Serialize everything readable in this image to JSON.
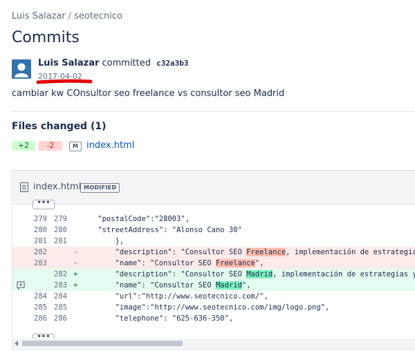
{
  "breadcrumb": {
    "owner": "Luis Salazar",
    "separator": "/",
    "repo": "seotecnico"
  },
  "page_title": "Commits",
  "commit": {
    "author": "Luis Salazar",
    "verb": "committed",
    "hash": "c32a3b3",
    "date": "2017-04-02",
    "message": "cambiar kw COnsultor seo freelance vs consultor seo Madrid"
  },
  "files_changed": {
    "title": "Files changed (1)",
    "added": "+2",
    "removed": "-2",
    "status_letter": "M",
    "file_name": "index.html"
  },
  "diff": {
    "file_name": "index.html",
    "status": "MODIFIED",
    "expand_label": "•••",
    "lines": [
      {
        "type": "ctx",
        "old": "279",
        "new": "279",
        "sign": "",
        "pre": "    \"postalCode\":\"28003\",",
        "hl": "",
        "post": ""
      },
      {
        "type": "ctx",
        "old": "280",
        "new": "280",
        "sign": "",
        "pre": "    \"streetAddress\": \"Alonso Cano 30\"",
        "hl": "",
        "post": ""
      },
      {
        "type": "ctx",
        "old": "281",
        "new": "281",
        "sign": "",
        "pre": "        },",
        "hl": "",
        "post": ""
      },
      {
        "type": "del",
        "old": "282",
        "new": "",
        "sign": "-",
        "pre": "        \"description\": \"Consultor SEO ",
        "hl": "Freelance",
        "post": ", implementación de estrategias"
      },
      {
        "type": "del",
        "old": "283",
        "new": "",
        "sign": "-",
        "pre": "        \"name\": \"Consultor SEO ",
        "hl": "Freelance",
        "post": "\","
      },
      {
        "type": "add",
        "old": "",
        "new": "282",
        "sign": "+",
        "pre": "        \"description\": \"Consultor SEO ",
        "hl": "Madrid",
        "post": ", implementación de estrategias y"
      },
      {
        "type": "add",
        "old": "",
        "new": "283",
        "sign": "+",
        "pre": "        \"name\": \"Consultor SEO ",
        "hl": "Madrid",
        "post": "\","
      },
      {
        "type": "ctx",
        "old": "284",
        "new": "284",
        "sign": "",
        "pre": "        \"url\":\"http://www.seotecnico.com/\",",
        "hl": "",
        "post": ""
      },
      {
        "type": "ctx",
        "old": "285",
        "new": "285",
        "sign": "",
        "pre": "        \"image\":\"http://www.seotecnico.com/img/logo.png\",",
        "hl": "",
        "post": ""
      },
      {
        "type": "ctx",
        "old": "286",
        "new": "286",
        "sign": "",
        "pre": "        \"telephone\": \"625-636-350\",",
        "hl": "",
        "post": ""
      }
    ]
  },
  "colors": {
    "avatar": "#3572b0",
    "link": "#0052cc",
    "del_bg": "#ffebe9",
    "add_bg": "#e3fcef",
    "del_highlight": "#ffbdad",
    "add_highlight": "#79f2c0",
    "annotation": "#e50000"
  },
  "icons": {
    "avatar": "user-avatar-icon",
    "file": "file-icon",
    "comment": "add-comment-icon"
  }
}
